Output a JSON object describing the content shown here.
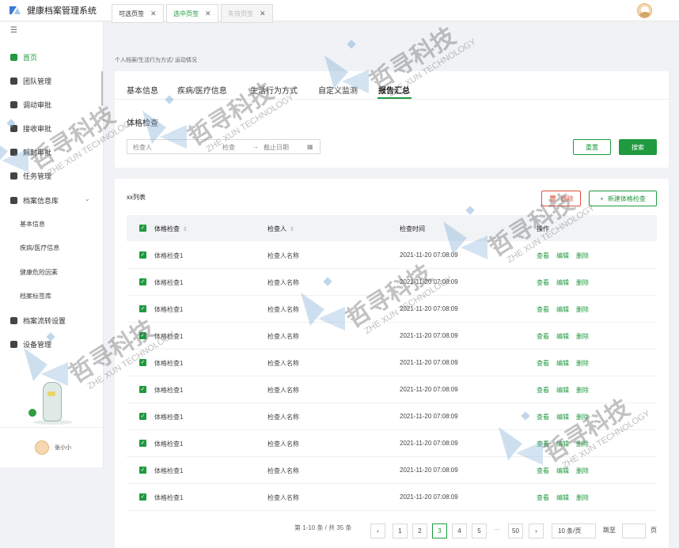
{
  "app": {
    "title": "健康档案管理系统"
  },
  "sidebar": {
    "items": [
      {
        "label": "首页"
      },
      {
        "label": "团队管理"
      },
      {
        "label": "调动审批"
      },
      {
        "label": "接收审批"
      },
      {
        "label": "解封审批"
      },
      {
        "label": "任务管理"
      },
      {
        "label": "档案信息库"
      },
      {
        "label": "档案流转设置"
      },
      {
        "label": "设备管理"
      }
    ],
    "sub_items": [
      {
        "label": "基本信息"
      },
      {
        "label": "疾病/医疗信息"
      },
      {
        "label": "健康危险因素"
      },
      {
        "label": "档案标签库"
      }
    ],
    "user_name": "张小小"
  },
  "tabs": [
    {
      "label": "可选页签"
    },
    {
      "label": "选中页签"
    },
    {
      "label": "失效页签"
    }
  ],
  "breadcrumb": "个人档案/生活行为方式/ 运动情况",
  "subtabs": [
    {
      "label": "基本信息"
    },
    {
      "label": "疾病/医疗信息"
    },
    {
      "label": "生活行为方式"
    },
    {
      "label": "自定义监测"
    },
    {
      "label": "报告汇总"
    }
  ],
  "filter": {
    "title": "体格检查",
    "inspector_placeholder": "检查人",
    "start_placeholder": "检查",
    "end_placeholder": "截止日期",
    "reset_label": "重置",
    "search_label": "搜索"
  },
  "list": {
    "title": "xx列表",
    "delete_label": "删除",
    "new_label": "新建体格检查",
    "headers": [
      "体格检查",
      "检查人",
      "检查时间",
      "操作"
    ],
    "actions": [
      "查看",
      "编辑",
      "删除"
    ],
    "rows": [
      {
        "name": "体格检查1",
        "inspector": "检查人名称",
        "time": "2021-11-20  07:08:09"
      },
      {
        "name": "体格检查1",
        "inspector": "检查人名称",
        "time": "2021-11-20  07:08:09"
      },
      {
        "name": "体格检查1",
        "inspector": "检查人名称",
        "time": "2021-11-20  07:08:09"
      },
      {
        "name": "体格检查1",
        "inspector": "检查人名称",
        "time": "2021-11-20  07:08:09"
      },
      {
        "name": "体格检查1",
        "inspector": "检查人名称",
        "time": "2021-11-20  07:08:09"
      },
      {
        "name": "体格检查1",
        "inspector": "检查人名称",
        "time": "2021-11-20  07:08:09"
      },
      {
        "name": "体格检查1",
        "inspector": "检查人名称",
        "time": "2021-11-20  07:08:09"
      },
      {
        "name": "体格检查1",
        "inspector": "检查人名称",
        "time": "2021-11-20  07:08:09"
      },
      {
        "name": "体格检查1",
        "inspector": "检查人名称",
        "time": "2021-11-20  07:08:09"
      },
      {
        "name": "体格检查1",
        "inspector": "检查人名称",
        "time": "2021-11-20  07:08:09"
      }
    ]
  },
  "pagination": {
    "summary": "第 1-10 条 / 共 35 条",
    "pages": [
      "1",
      "2",
      "3",
      "4",
      "5"
    ],
    "current": "3",
    "ellipsis": "···",
    "last": "50",
    "page_size": "10 条/页",
    "goto_label": "跳至",
    "goto_suffix": "页"
  },
  "watermark": {
    "brand": "哲寻科技",
    "english": "ZHE XUN TECHNOLOGY"
  },
  "colors": {
    "primary": "#1f9a3f",
    "danger": "#e0523f",
    "header_bg": "#f2f3f5",
    "page_bg": "#f0f2f5"
  }
}
